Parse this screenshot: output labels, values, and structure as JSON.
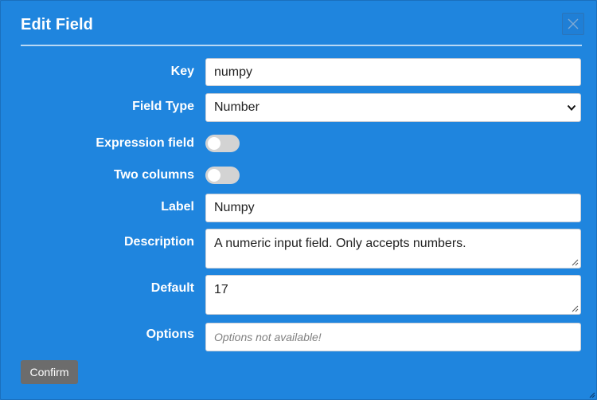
{
  "dialog": {
    "title": "Edit Field",
    "close_icon": "close-icon"
  },
  "form": {
    "key": {
      "label": "Key",
      "value": "numpy"
    },
    "field_type": {
      "label": "Field Type",
      "value": "Number",
      "icon": "chevron-down-icon"
    },
    "expression_field": {
      "label": "Expression field",
      "checked": false
    },
    "two_columns": {
      "label": "Two columns",
      "checked": false
    },
    "label_field": {
      "label": "Label",
      "value": "Numpy"
    },
    "description": {
      "label": "Description",
      "value": "A numeric input field. Only accepts numbers."
    },
    "default": {
      "label": "Default",
      "value": "17"
    },
    "options": {
      "label": "Options",
      "placeholder": "Options not available!"
    }
  },
  "actions": {
    "confirm_label": "Confirm"
  },
  "colors": {
    "dialog_background": "#1f85de",
    "confirm_button": "#6c6c6c",
    "toggle_off": "#d3d3d3"
  }
}
